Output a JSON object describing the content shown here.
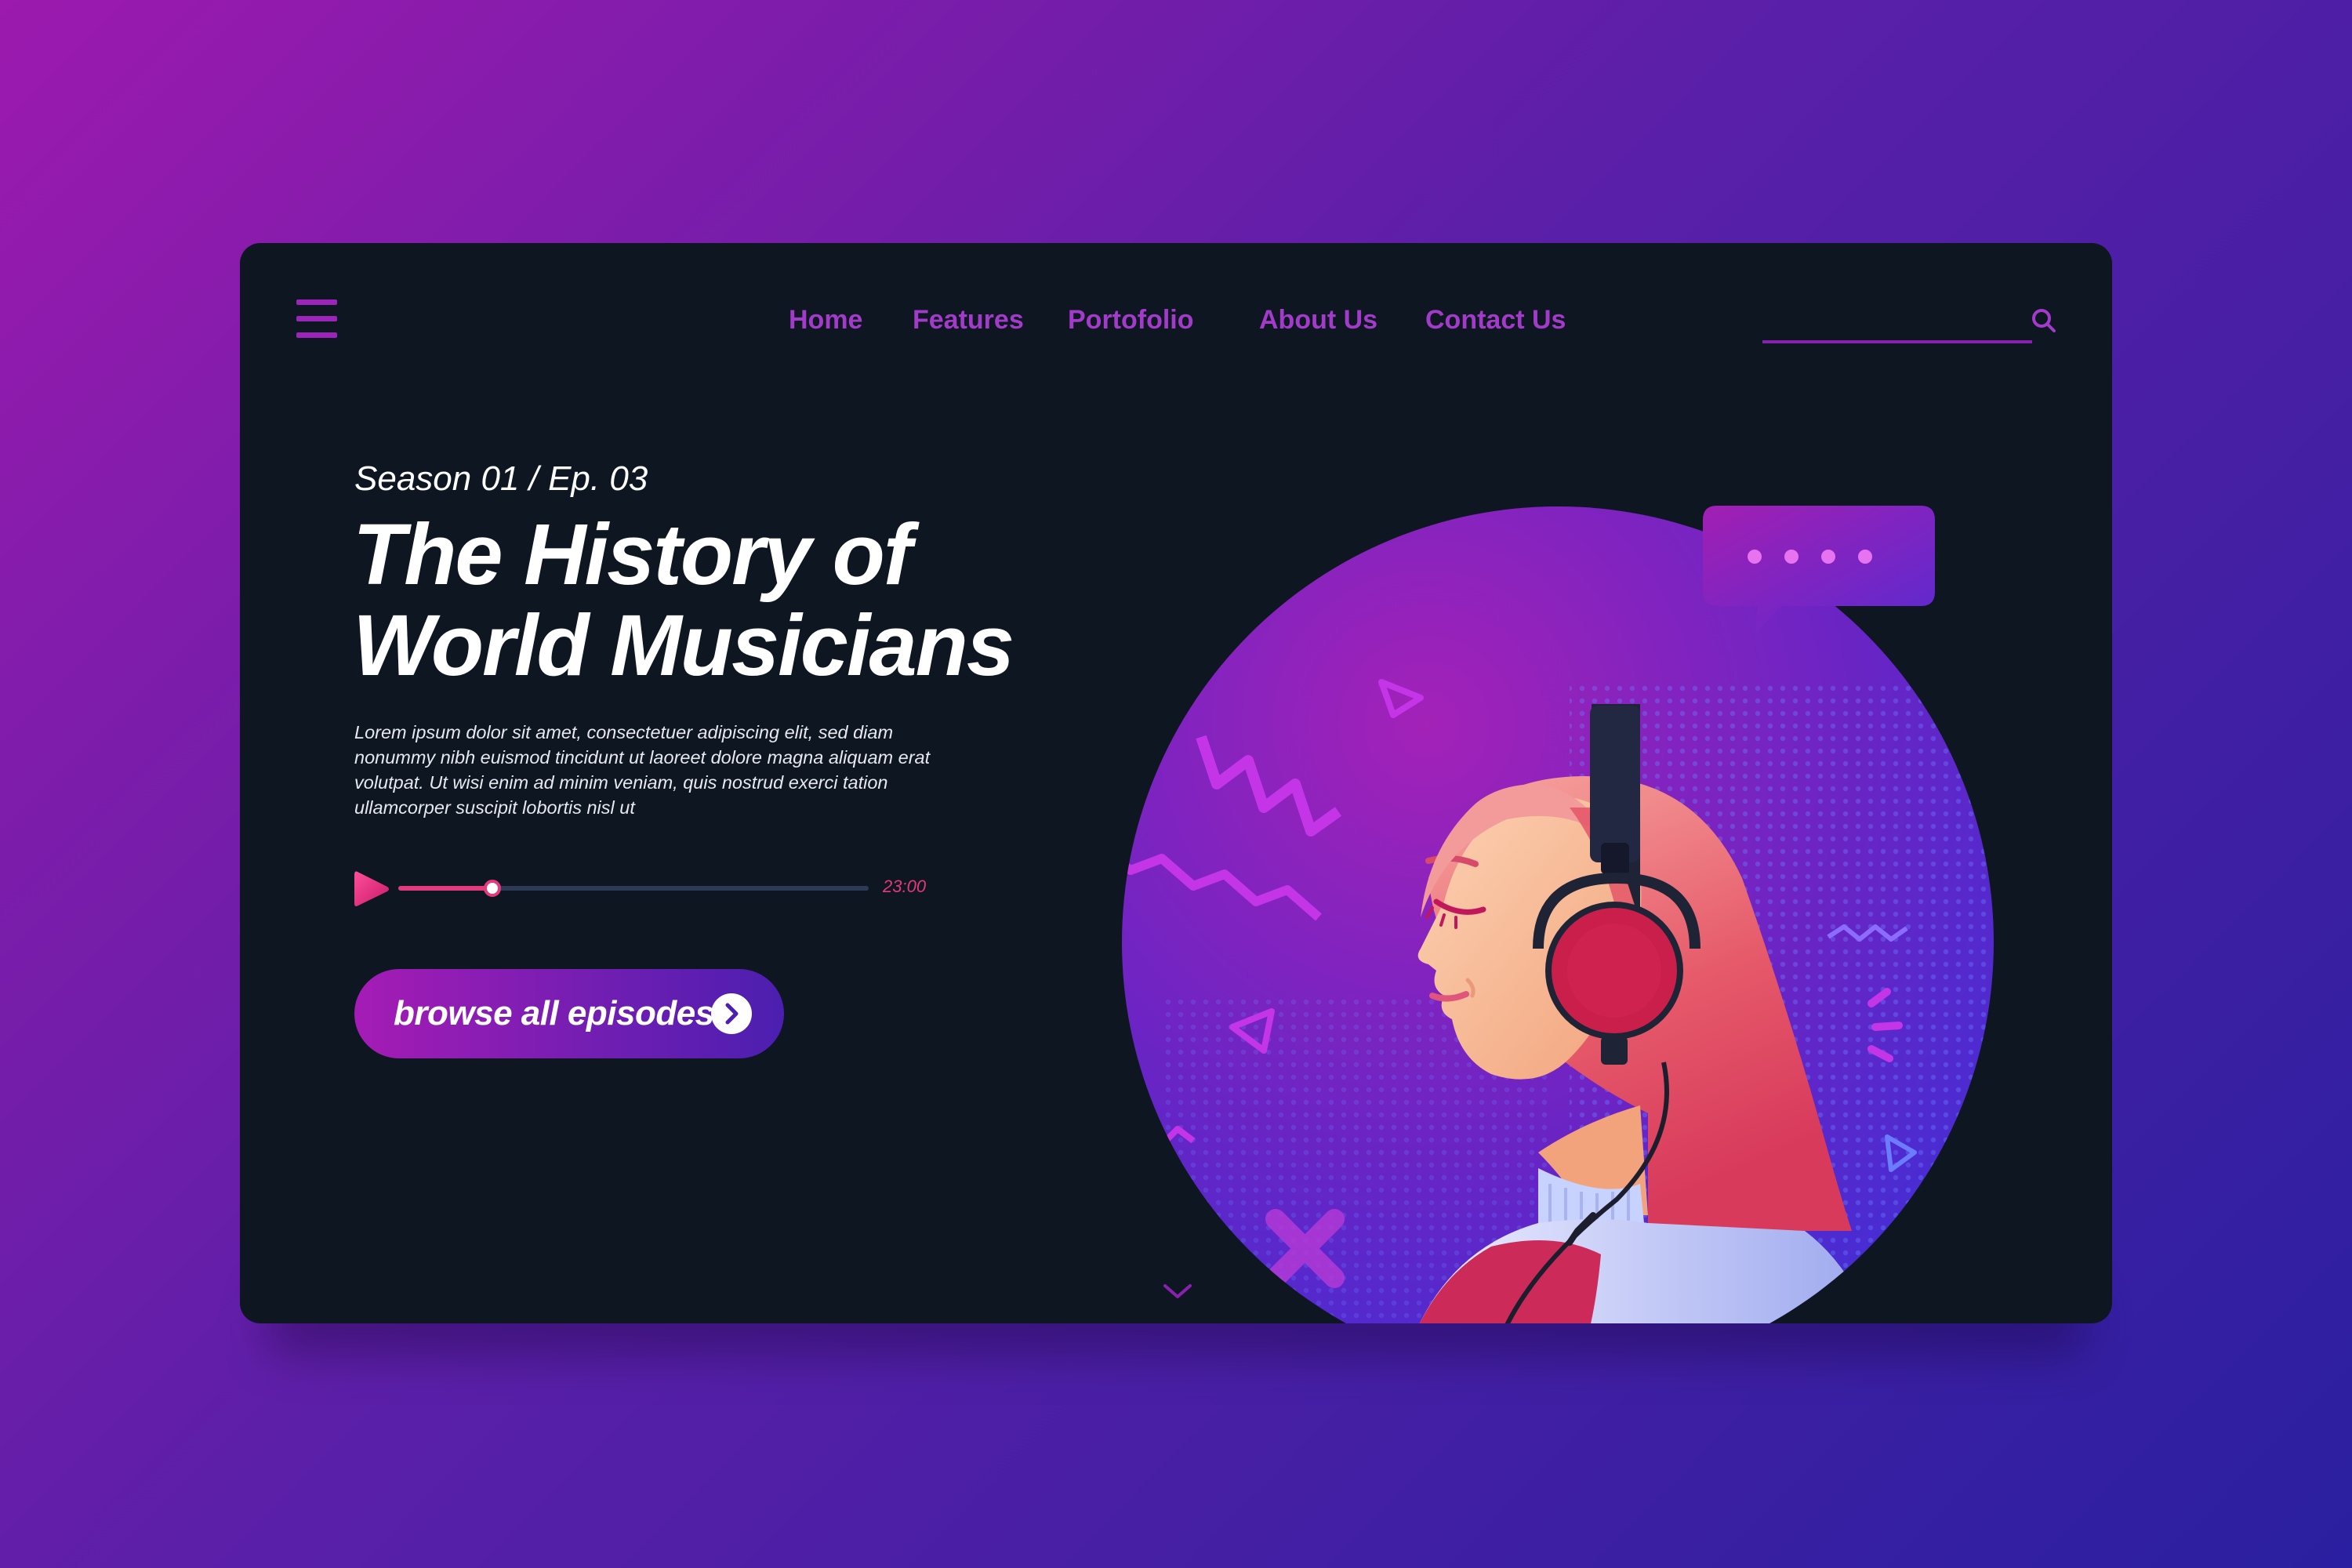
{
  "nav": {
    "menu_icon": "hamburger-menu-icon",
    "links": [
      "Home",
      "Features",
      "Portofolio",
      "About Us",
      "Contact Us"
    ],
    "search_placeholder": "",
    "search_icon": "search-icon"
  },
  "hero": {
    "episode": "Season 01 / Ep. 03",
    "title_line1": "The History of",
    "title_line2": "World Musicians",
    "description": "Lorem ipsum dolor sit amet, consectetuer adipiscing elit, sed diam nonummy nibh euismod tincidunt ut laoreet dolore magna aliquam erat volutpat. Ut wisi enim ad minim veniam, quis nostrud exerci tation ullamcorper suscipit lobortis nisl ut"
  },
  "player": {
    "play_icon": "play-icon",
    "progress": 0.2,
    "duration": "23:00"
  },
  "cta": {
    "label": "browse all episodes",
    "icon": "arrow-right-circle-icon"
  },
  "scroll_icon": "chevron-down-icon",
  "colors": {
    "accent": "#a23bc9",
    "card_bg": "#0e1621",
    "player_accent": "#e23a7b",
    "bg_gradient_start": "#9c1aae",
    "bg_gradient_end": "#2a1fa0"
  }
}
